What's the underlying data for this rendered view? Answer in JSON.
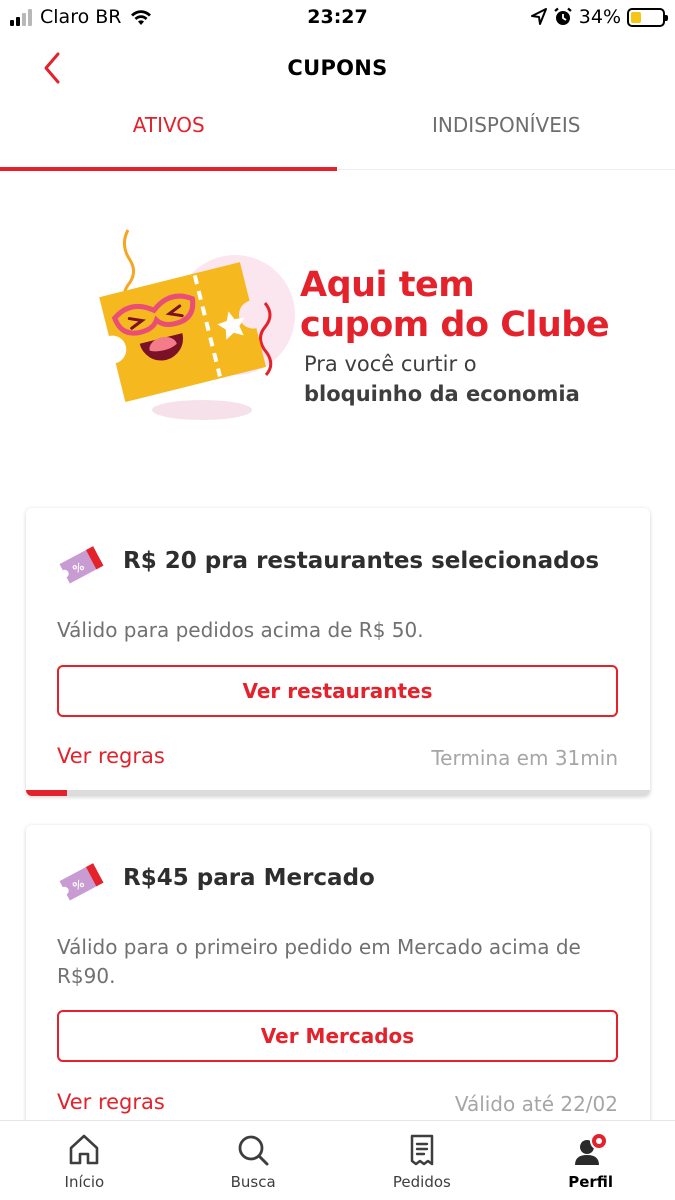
{
  "status_bar": {
    "carrier": "Claro BR",
    "time": "23:27",
    "battery_percent": "34%",
    "battery_level": 0.34
  },
  "header": {
    "title": "CUPONS"
  },
  "tabs": [
    {
      "label": "ATIVOS",
      "active": true
    },
    {
      "label": "INDISPONÍVEIS",
      "active": false
    }
  ],
  "banner": {
    "title_line1": "Aqui tem",
    "title_line2": "cupom do Clube",
    "subtitle_line1": "Pra você curtir o",
    "subtitle_line2": "bloquinho da economia"
  },
  "coupons": [
    {
      "title": "R$ 20 pra restaurantes selecionados",
      "description": "Válido para pedidos acima de R$ 50.",
      "button_label": "Ver restaurantes",
      "rules_label": "Ver regras",
      "expiry": "Termina em 31min",
      "progress": 0.066
    },
    {
      "title": "R$45 para Mercado",
      "description": "Válido para o primeiro pedido em Mercado acima de R$90.",
      "button_label": "Ver Mercados",
      "rules_label": "Ver regras",
      "expiry": "Válido até 22/02"
    }
  ],
  "bottom_nav": [
    {
      "label": "Início",
      "icon": "home-icon"
    },
    {
      "label": "Busca",
      "icon": "search-icon"
    },
    {
      "label": "Pedidos",
      "icon": "orders-icon"
    },
    {
      "label": "Perfil",
      "icon": "profile-icon",
      "active": true
    }
  ],
  "colors": {
    "accent": "#e3222c",
    "coupon_icon": "#c89bd3",
    "banner_ticket": "#f5b91f"
  }
}
